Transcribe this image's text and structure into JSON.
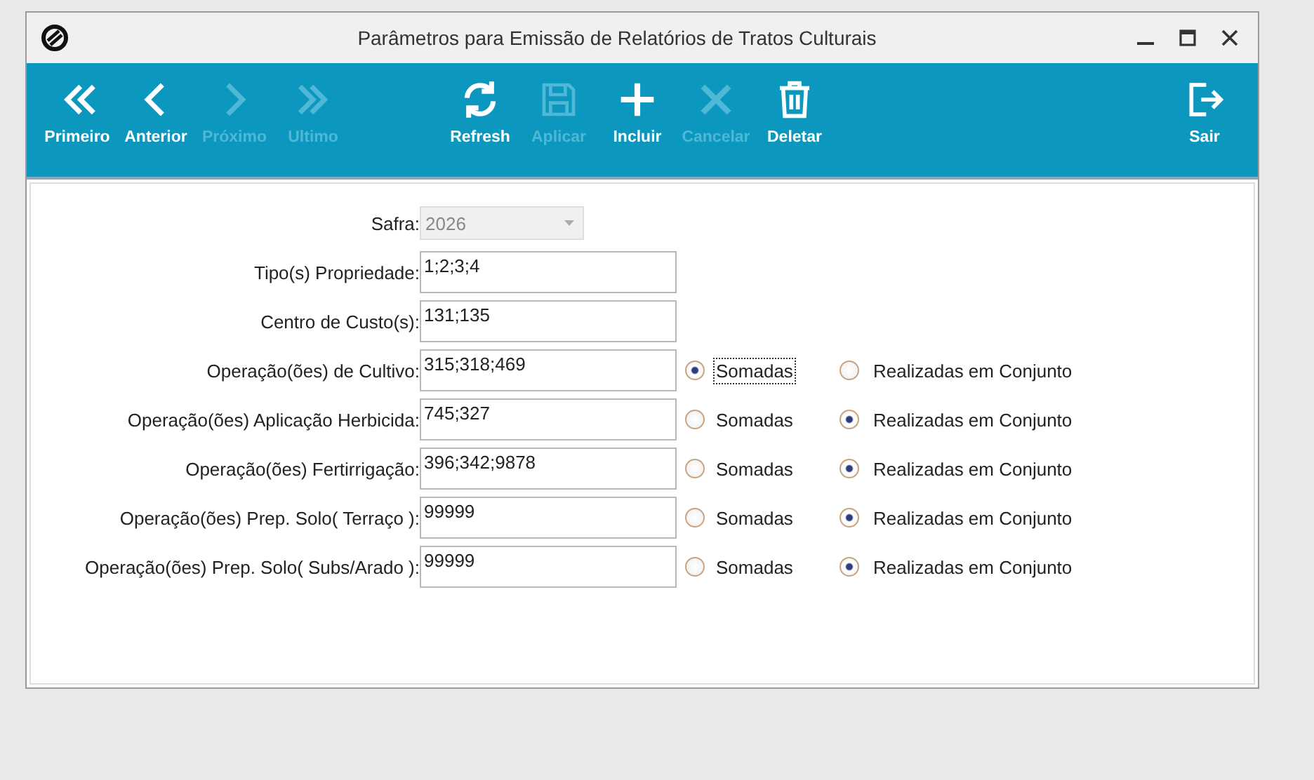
{
  "window": {
    "title": "Parâmetros para Emissão de Relatórios de Tratos Culturais"
  },
  "toolbar": {
    "navigation": [
      {
        "label": "Primeiro",
        "kind": "first",
        "disabled": false
      },
      {
        "label": "Anterior",
        "kind": "prev",
        "disabled": false
      },
      {
        "label": "Próximo",
        "kind": "next",
        "disabled": true
      },
      {
        "label": "Ultimo",
        "kind": "last",
        "disabled": true
      }
    ],
    "actions": [
      {
        "label": "Refresh",
        "kind": "refresh",
        "disabled": false
      },
      {
        "label": "Aplicar",
        "kind": "save",
        "disabled": true
      },
      {
        "label": "Incluir",
        "kind": "add",
        "disabled": false
      },
      {
        "label": "Cancelar",
        "kind": "cancel",
        "disabled": true
      },
      {
        "label": "Deletar",
        "kind": "delete",
        "disabled": false
      }
    ],
    "exit": [
      {
        "label": "Sair",
        "kind": "exit",
        "disabled": false
      }
    ]
  },
  "form": [
    {
      "label": "Safra:",
      "kind": "combo",
      "value": "2026",
      "disabled": true
    },
    {
      "label": "Tipo(s) Propriedade:",
      "kind": "text",
      "value": "1;2;3;4"
    },
    {
      "label": "Centro de Custo(s):",
      "kind": "text",
      "value": "131;135"
    },
    {
      "label": "Operação(ões) de Cultivo:",
      "kind": "text",
      "value": "315;318;469",
      "options": [
        {
          "label": "Somadas",
          "selected": true,
          "focused": true
        },
        {
          "label": "Realizadas em Conjunto",
          "selected": false,
          "focused": false
        }
      ]
    },
    {
      "label": "Operação(ões) Aplicação Herbicida:",
      "kind": "text",
      "value": "745;327",
      "options": [
        {
          "label": "Somadas",
          "selected": false,
          "focused": false
        },
        {
          "label": "Realizadas em Conjunto",
          "selected": true,
          "focused": false
        }
      ]
    },
    {
      "label": "Operação(ões) Fertirrigação:",
      "kind": "text",
      "value": "396;342;9878",
      "options": [
        {
          "label": "Somadas",
          "selected": false,
          "focused": false
        },
        {
          "label": "Realizadas em Conjunto",
          "selected": true,
          "focused": false
        }
      ]
    },
    {
      "label": "Operação(ões) Prep. Solo( Terraço ):",
      "kind": "text",
      "value": "99999",
      "options": [
        {
          "label": "Somadas",
          "selected": false,
          "focused": false
        },
        {
          "label": "Realizadas em Conjunto",
          "selected": true,
          "focused": false
        }
      ]
    },
    {
      "label": "Operação(ões) Prep. Solo( Subs/Arado ):",
      "kind": "text",
      "value": "99999",
      "options": [
        {
          "label": "Somadas",
          "selected": false,
          "focused": false
        },
        {
          "label": "Realizadas em Conjunto",
          "selected": true,
          "focused": false
        }
      ]
    }
  ]
}
